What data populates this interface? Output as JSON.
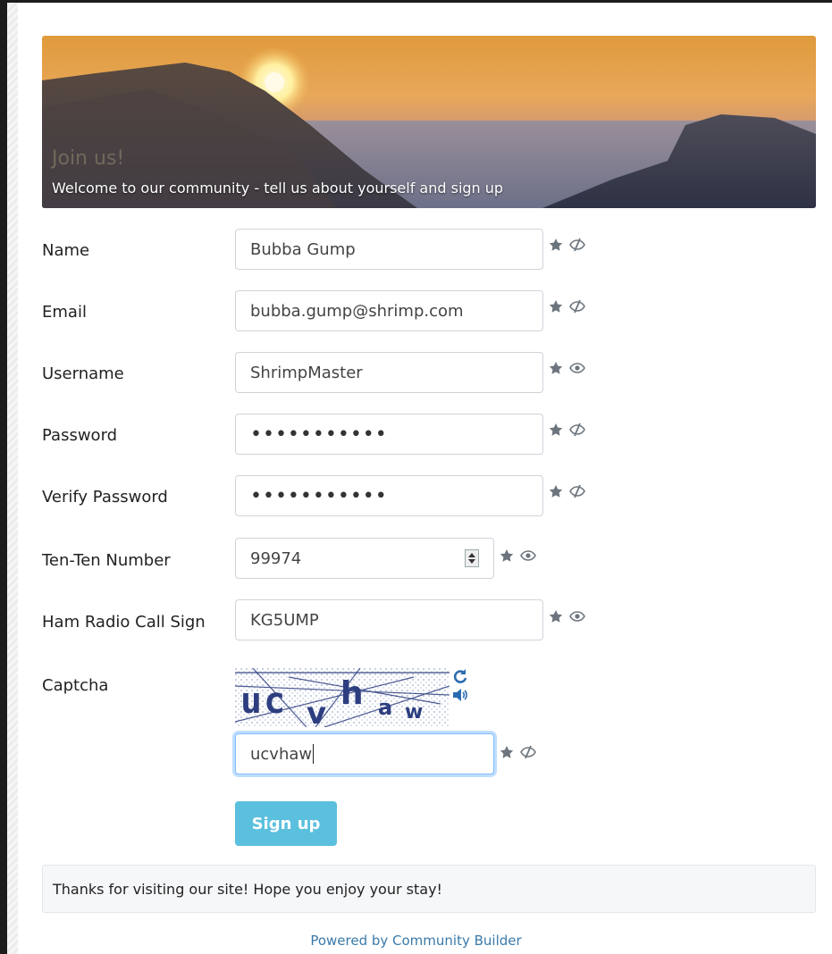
{
  "banner": {
    "title": "Join us!",
    "subtitle": "Welcome to our community - tell us about yourself and sign up"
  },
  "form": {
    "fields": [
      {
        "label": "Name",
        "value": "Bubba Gump",
        "visibility": "hidden-eye-icon"
      },
      {
        "label": "Email",
        "value": "bubba.gump@shrimp.com",
        "visibility": "hidden-eye-icon"
      },
      {
        "label": "Username",
        "value": "ShrimpMaster",
        "visibility": "eye-icon"
      },
      {
        "label": "Password",
        "value": "•••••••••••",
        "visibility": "hidden-eye-icon"
      },
      {
        "label": "Verify Password",
        "value": "•••••••••••",
        "visibility": "hidden-eye-icon"
      },
      {
        "label": "Ten-Ten Number",
        "value": "99974",
        "visibility": "eye-icon"
      },
      {
        "label": "Ham Radio Call Sign",
        "value": "KG5UMP",
        "visibility": "eye-icon"
      }
    ],
    "captcha": {
      "label": "Captcha",
      "image_text": "ucvhaw",
      "value": "ucvhaw",
      "visibility": "hidden-eye-icon"
    },
    "signup_label": "Sign up"
  },
  "footer": {
    "message": "Thanks for visiting our site! Hope you enjoy your stay!",
    "powered_by": "Powered by Community Builder"
  },
  "colors": {
    "button": "#5bc0de",
    "icon": "#6c757d",
    "link": "#3a7aa8"
  }
}
